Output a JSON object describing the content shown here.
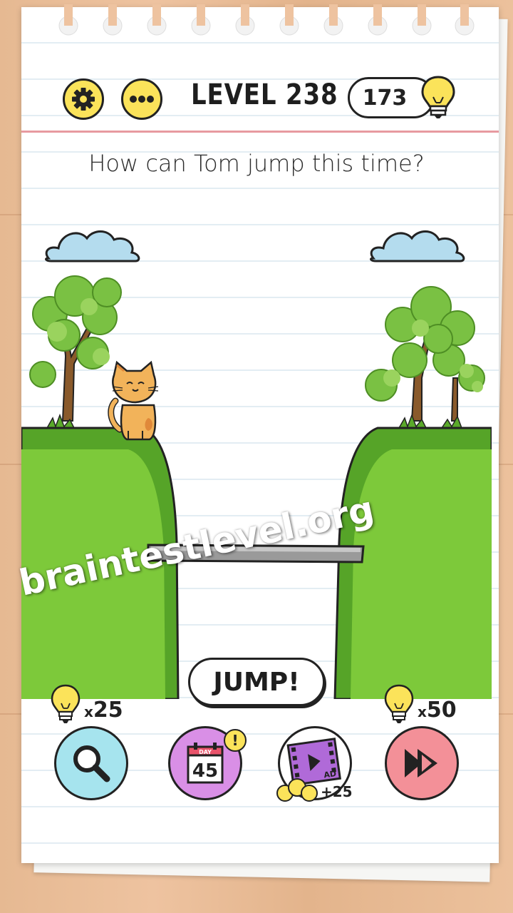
{
  "header": {
    "level_title": "LEVEL 238",
    "hint_count": "173",
    "settings_icon": "gear-icon",
    "more_icon": "ellipsis-icon",
    "hint_icon": "lightbulb-icon"
  },
  "puzzle": {
    "question": "How can Tom jump this time?",
    "character": "Tom the cat",
    "jump_label": "JUMP!"
  },
  "watermark": "braintestlevel.org",
  "footer": {
    "hint_cost": "25",
    "skip_cost": "50",
    "daily_day_label": "DAY",
    "daily_day_number": "45",
    "daily_alert": "!",
    "ad_label": "AD",
    "ad_reward": "+25",
    "hint_button_icon": "magnifier-icon",
    "daily_button_icon": "calendar-icon",
    "ad_button_icon": "film-play-icon",
    "skip_button_icon": "fast-forward-icon"
  },
  "colors": {
    "button_yellow": "#fbe35a",
    "grass": "#7dc93a",
    "grass_dark": "#56a428",
    "hint_button": "#a6e4ee",
    "daily_button": "#d98fe6",
    "ad_button": "#ffffff",
    "skip_button": "#f39098"
  }
}
